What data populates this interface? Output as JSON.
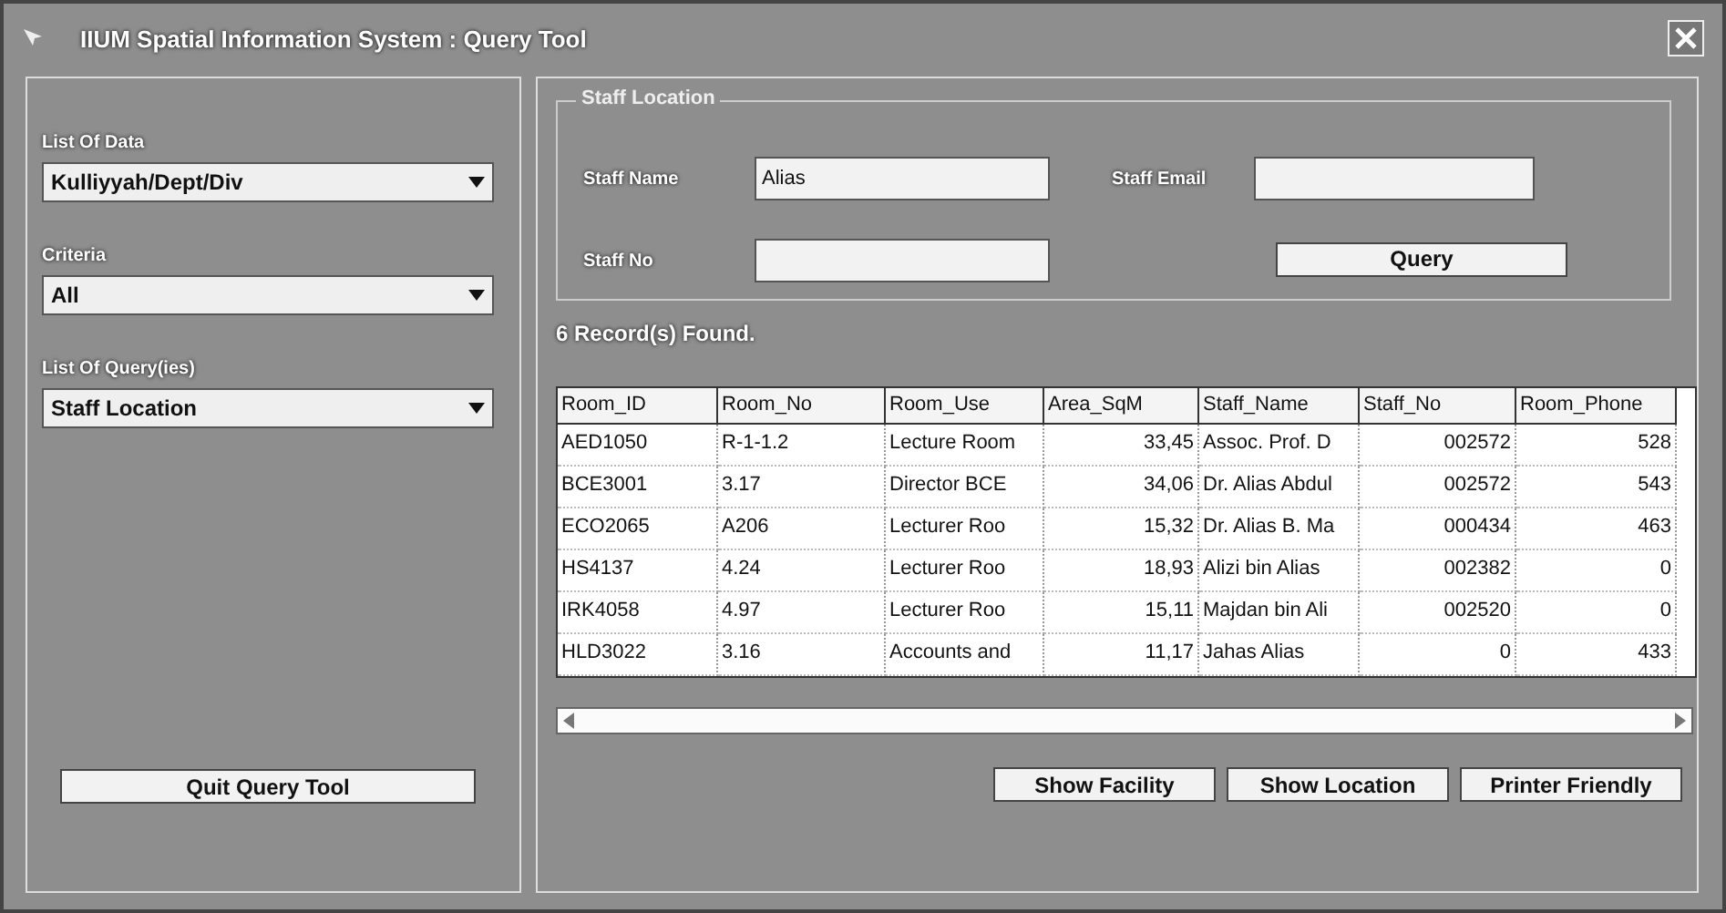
{
  "window": {
    "title": "IIUM Spatial Information System : Query Tool"
  },
  "left_panel": {
    "fields": [
      {
        "label": "List Of Data",
        "value": "Kulliyyah/Dept/Div"
      },
      {
        "label": "Criteria",
        "value": "All"
      },
      {
        "label": "List Of Query(ies)",
        "value": "Staff Location"
      }
    ],
    "quit_button": "Quit Query Tool"
  },
  "staff_location": {
    "title": "Staff Location",
    "staff_name": {
      "label": "Staff Name",
      "value": "Alias"
    },
    "staff_no": {
      "label": "Staff No"
    },
    "staff_email": {
      "label": "Staff Email"
    },
    "query_button": "Query"
  },
  "records_found": "6 Record(s) Found.",
  "table": {
    "columns": [
      "Room_ID",
      "Room_No",
      "Room_Use",
      "Area_SqM",
      "Staff_Name",
      "Staff_No",
      "Room_Phone"
    ],
    "rows": [
      [
        "AED1050",
        "R-1-1.2",
        "Lecture Room",
        "33,45",
        "Assoc. Prof. D",
        "002572",
        "528"
      ],
      [
        "BCE3001",
        "3.17",
        "Director BCE",
        "34,06",
        "Dr. Alias Abdul",
        "002572",
        "543"
      ],
      [
        "ECO2065",
        "A206",
        "Lecturer Roo",
        "15,32",
        "Dr. Alias B. Ma",
        "000434",
        "463"
      ],
      [
        "HS4137",
        "4.24",
        "Lecturer Roo",
        "18,93",
        "Alizi bin Alias",
        "002382",
        "0"
      ],
      [
        "IRK4058",
        "4.97",
        "Lecturer Roo",
        "15,11",
        "Majdan bin Ali",
        "002520",
        "0"
      ],
      [
        "HLD3022",
        "3.16",
        "Accounts and",
        "11,17",
        "Jahas Alias",
        "0",
        "433"
      ]
    ]
  },
  "buttons": [
    "Show Facility",
    "Show Location",
    "Printer Friendly"
  ]
}
